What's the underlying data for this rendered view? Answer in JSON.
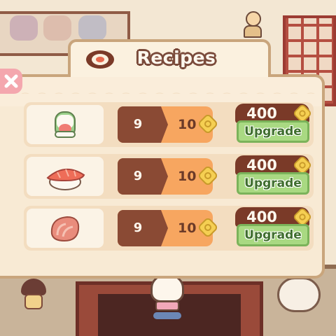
{
  "modal": {
    "title": "Recipes",
    "close_icon": "close-x-icon",
    "title_icon": "sushi-roll-icon"
  },
  "recipes": [
    {
      "dish_icon": "maki-roll-icon",
      "current_level": "9",
      "next_level": "10",
      "cost": "400",
      "upgrade_label": "Upgrade"
    },
    {
      "dish_icon": "tuna-nigiri-icon",
      "current_level": "9",
      "next_level": "10",
      "cost": "400",
      "upgrade_label": "Upgrade"
    },
    {
      "dish_icon": "sashimi-icon",
      "current_level": "9",
      "next_level": "10",
      "cost": "400",
      "upgrade_label": "Upgrade"
    }
  ],
  "colors": {
    "level_dark": "#8a4a34",
    "level_light": "#f7a660",
    "cost_bg": "#7a3a28",
    "upgrade_green": "#a9d982",
    "coin_gold": "#f5cf52",
    "close_pink": "#f4a7ae"
  }
}
